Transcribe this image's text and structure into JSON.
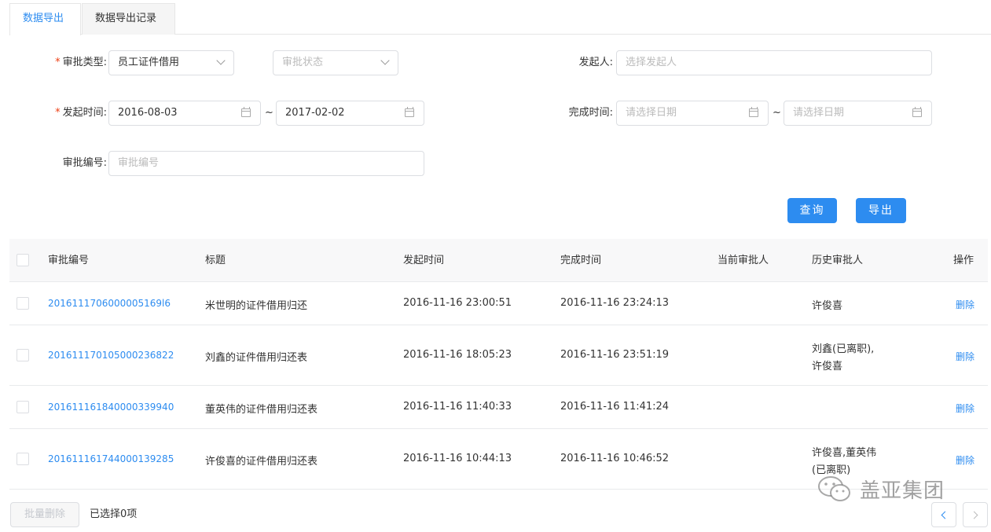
{
  "tabs": [
    "数据导出",
    "数据导出记录"
  ],
  "form": {
    "approval_type_label": "审批类型:",
    "approval_type_value": "员工证件借用",
    "approval_status_placeholder": "审批状态",
    "initiator_label": "发起人:",
    "initiator_placeholder": "选择发起人",
    "start_time_label": "发起时间:",
    "start_date_from": "2016-08-03",
    "start_date_to": "2017-02-02",
    "tilde": "~",
    "finish_time_label": "完成时间:",
    "finish_date_placeholder": "请选择日期",
    "approval_no_label": "审批编号:",
    "approval_no_placeholder": "审批编号"
  },
  "buttons": {
    "query": "查询",
    "export": "导出",
    "batch_delete": "批量删除"
  },
  "table": {
    "columns": [
      "审批编号",
      "标题",
      "发起时间",
      "完成时间",
      "当前审批人",
      "历史审批人",
      "操作"
    ],
    "rows": [
      {
        "id": "2016111706000005169l6",
        "title": "米世明的证件借用归还",
        "start": "2016-11-16 23:00:51",
        "end": "2016-11-16 23:24:13",
        "current": "",
        "history": [
          "许俊喜"
        ],
        "action": "删除"
      },
      {
        "id": "201611170105000236822",
        "title": "刘鑫的证件借用归还表",
        "start": "2016-11-16 18:05:23",
        "end": "2016-11-16 23:51:19",
        "current": "",
        "history": [
          "刘鑫(已离职),",
          "许俊喜"
        ],
        "action": "删除"
      },
      {
        "id": "201611161840000339940",
        "title": "董英伟的证件借用归还表",
        "start": "2016-11-16 11:40:33",
        "end": "2016-11-16 11:41:24",
        "current": "",
        "history": [],
        "action": "删除"
      },
      {
        "id": "201611161744000139285",
        "title": "许俊喜的证件借用归还表",
        "start": "2016-11-16 10:44:13",
        "end": "2016-11-16 10:46:52",
        "current": "",
        "history": [
          "许俊喜,董英伟",
          "(已离职)"
        ],
        "action": "删除"
      }
    ]
  },
  "footer": {
    "selected_text": "已选择0项"
  },
  "watermark": {
    "text": "盖亚集团"
  },
  "colors": {
    "accent": "#2d8cf0",
    "required": "#ed3f14"
  }
}
